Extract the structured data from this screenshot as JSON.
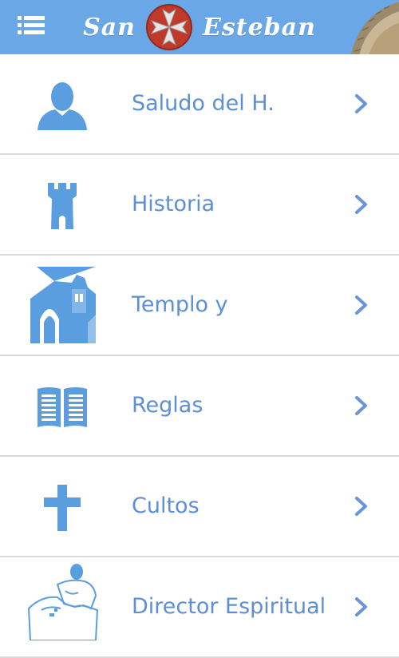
{
  "header": {
    "title_left": "San",
    "title_right": "Esteban",
    "menu_icon": "hamburger-icon",
    "logo_icon": "cross-emblem-icon"
  },
  "colors": {
    "header_bg": "#6aa7e6",
    "accent": "#5d8fd6",
    "divider": "#d9d9d9",
    "logo_red": "#c0392b"
  },
  "menu": {
    "items": [
      {
        "label": "Saludo del H.",
        "icon": "person-icon"
      },
      {
        "label": "Historia",
        "icon": "tower-icon"
      },
      {
        "label": "Templo y",
        "icon": "church-icon"
      },
      {
        "label": "Reglas",
        "icon": "book-icon"
      },
      {
        "label": "Cultos",
        "icon": "cross-icon"
      },
      {
        "label": "Director Espiritual",
        "icon": "saint-icon"
      }
    ]
  }
}
